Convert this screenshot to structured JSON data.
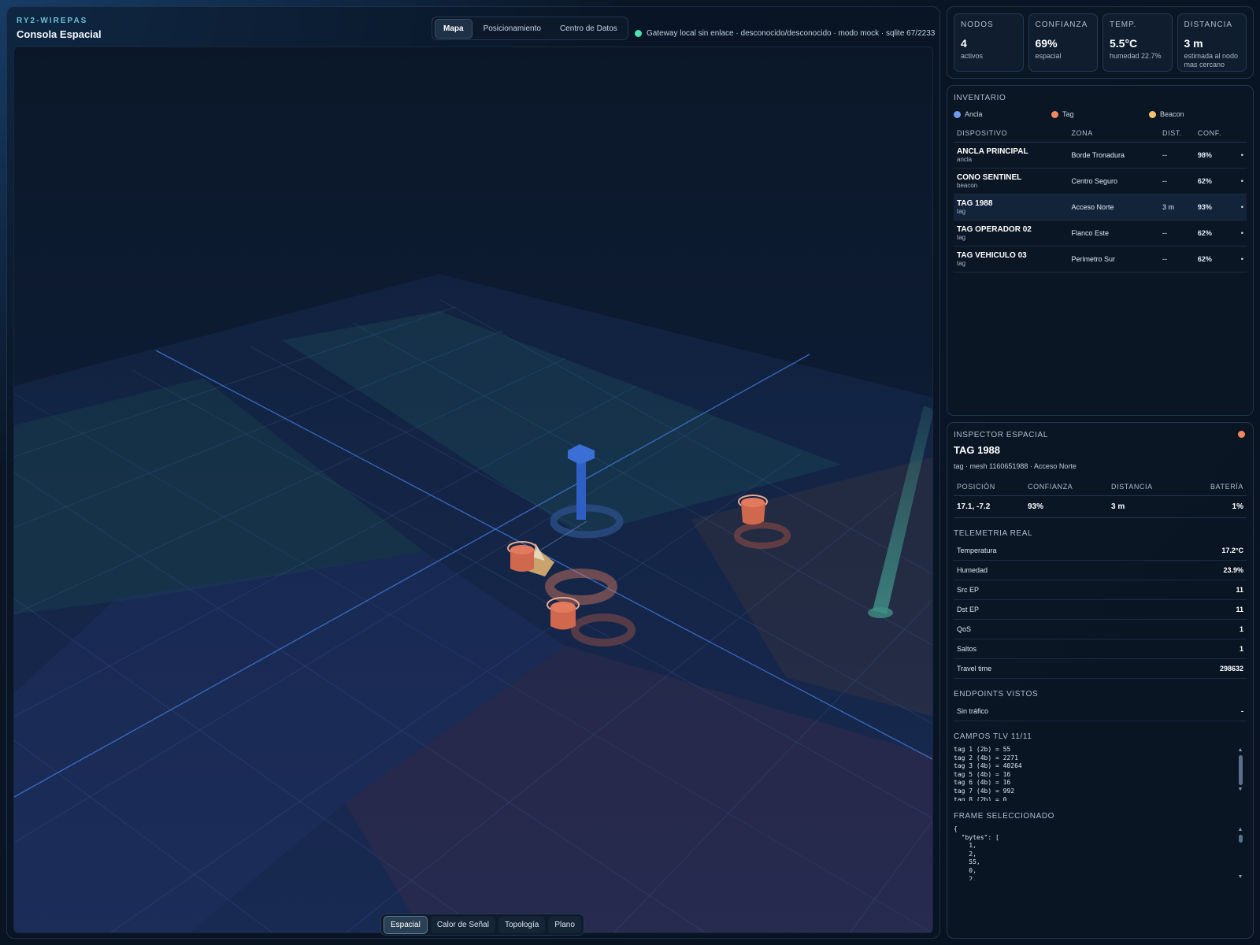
{
  "brand": {
    "kicker": "RY2-WIREPAS",
    "title": "Consola Espacial"
  },
  "view_tabs": [
    {
      "label": "Mapa",
      "active": true
    },
    {
      "label": "Posicionamiento",
      "active": false
    },
    {
      "label": "Centro de Datos",
      "active": false
    }
  ],
  "gateway": {
    "status_text": "Gateway local sin enlace · desconocido/desconocido · modo mock · sqlite 67/2233",
    "status_color": "#4de3b0"
  },
  "mode_tabs": [
    {
      "label": "Espacial",
      "active": true
    },
    {
      "label": "Calor de Señal",
      "active": false
    },
    {
      "label": "Topología",
      "active": false
    },
    {
      "label": "Plano",
      "active": false
    }
  ],
  "stats": [
    {
      "label": "NODOS",
      "value": "4",
      "sub": "activos"
    },
    {
      "label": "CONFIANZA",
      "value": "69%",
      "sub": "espacial"
    },
    {
      "label": "TEMP.",
      "value": "5.5°C",
      "sub": "humedad 22.7%"
    },
    {
      "label": "DISTANCIA",
      "value": "3 m",
      "sub": "estimada al nodo mas cercano"
    }
  ],
  "inventory": {
    "title": "INVENTARIO",
    "legend": [
      {
        "label": "Ancla",
        "color": "#6f9cf0"
      },
      {
        "label": "Tag",
        "color": "#f3895f"
      },
      {
        "label": "Beacon",
        "color": "#f5c26b"
      }
    ],
    "headers": {
      "device": "DISPOSITIVO",
      "zone": "ZONA",
      "dist": "DIST.",
      "conf": "CONF."
    },
    "rows": [
      {
        "name": "ANCLA PRINCIPAL",
        "type": "ancla",
        "zone": "Borde Tronadura",
        "dist": "--",
        "conf": "98%"
      },
      {
        "name": "CONO SENTINEL",
        "type": "beacon",
        "zone": "Centro Seguro",
        "dist": "--",
        "conf": "62%"
      },
      {
        "name": "TAG 1988",
        "type": "tag",
        "zone": "Acceso Norte",
        "dist": "3 m",
        "conf": "93%"
      },
      {
        "name": "TAG OPERADOR 02",
        "type": "tag",
        "zone": "Flanco Este",
        "dist": "--",
        "conf": "62%"
      },
      {
        "name": "TAG VEHICULO 03",
        "type": "tag",
        "zone": "Perimetro Sur",
        "dist": "--",
        "conf": "62%"
      }
    ]
  },
  "inspector": {
    "section": "INSPECTOR ESPACIAL",
    "title": "TAG 1988",
    "subtitle": "tag · mesh 1160651988 · Acceso Norte",
    "kpi_headers": {
      "pos": "POSICIÓN",
      "conf": "CONFIANZA",
      "dist": "DISTANCIA",
      "bat": "BATERÍA"
    },
    "kpi_values": {
      "pos": "17.1, -7.2",
      "conf": "93%",
      "dist": "3 m",
      "bat": "1%"
    },
    "telemetry_title": "TELEMETRIA REAL",
    "telemetry": [
      {
        "k": "Temperatura",
        "v": "17.2°C"
      },
      {
        "k": "Humedad",
        "v": "23.9%"
      },
      {
        "k": "Src EP",
        "v": "11"
      },
      {
        "k": "Dst EP",
        "v": "11"
      },
      {
        "k": "QoS",
        "v": "1"
      },
      {
        "k": "Saltos",
        "v": "1"
      },
      {
        "k": "Travel time",
        "v": "298632"
      }
    ],
    "endpoints_title": "ENDPOINTS VISTOS",
    "endpoints": [
      {
        "k": "Sin tráfico",
        "v": "-"
      }
    ],
    "tlv_title": "CAMPOS TLV 11/11",
    "tlv_text": "tag 1 (2b) = 55\ntag 2 (4b) = 2271\ntag 3 (4b) = 40264\ntag 5 (4b) = 16\ntag 6 (4b) = 16\ntag 7 (4b) = 992\ntag 8 (2b) = 0",
    "frame_title": "FRAME SELECCIONADO",
    "frame_text": "{\n  \"bytes\": [\n    1,\n    2,\n    55,\n    0,\n    2,"
  }
}
